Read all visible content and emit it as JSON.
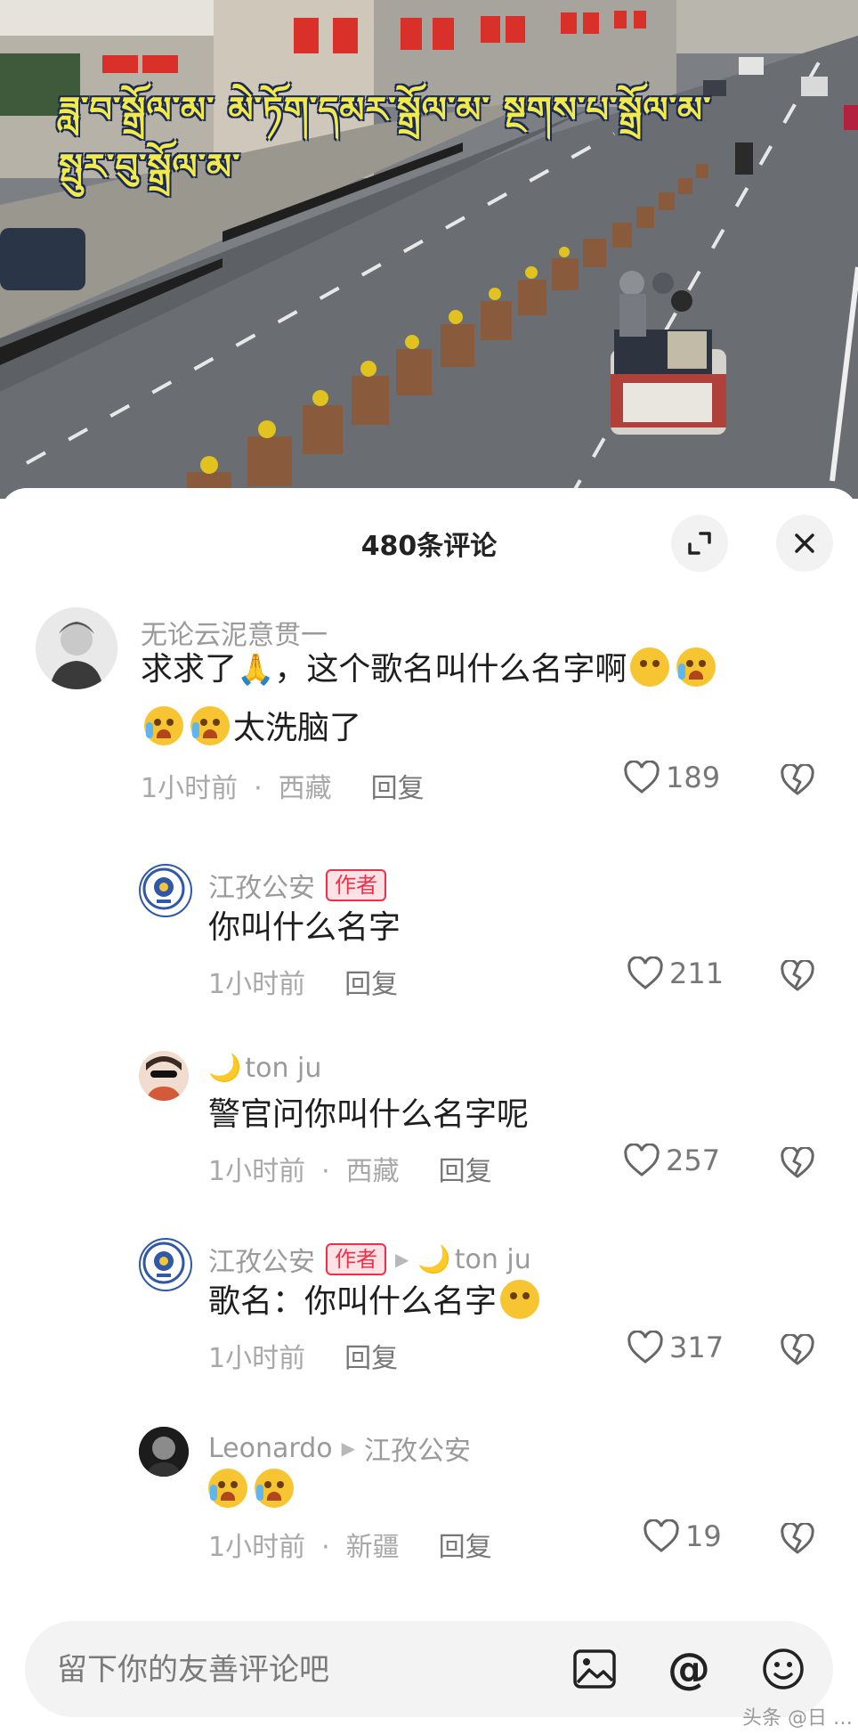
{
  "video": {
    "subtitle_lines": [
      "ཟླ་བ་སྒྲོལ་མ་  མེ་ཏོག་དམར་སྒྲོལ་མ་  སྔགས་པ་སྒྲོལ་མ་",
      "སྤུར་བུ་སྒྲོལ་མ་"
    ]
  },
  "sheet": {
    "title": "480条评论",
    "expand_icon": "expand-icon",
    "close_icon": "close-icon"
  },
  "comments": [
    {
      "user": "无论云泥意贯一",
      "text_line1_a": "求求了",
      "text_line1_b": "，这个歌名叫什么名字啊",
      "text_line2": "太洗脑了",
      "time": "1小时前",
      "location": "西藏",
      "reply": "回复",
      "likes": "189"
    },
    {
      "user": "江孜公安",
      "badge": "作者",
      "text": "你叫什么名字",
      "time": "1小时前",
      "reply": "回复",
      "likes": "211"
    },
    {
      "user": "ton ju",
      "text": "警官问你叫什么名字呢",
      "time": "1小时前",
      "location": "西藏",
      "reply": "回复",
      "likes": "257"
    },
    {
      "user": "江孜公安",
      "badge": "作者",
      "reply_to": "ton ju",
      "text": "歌名：你叫什么名字",
      "time": "1小时前",
      "reply": "回复",
      "likes": "317"
    },
    {
      "user": "Leonardo",
      "reply_to": "江孜公安",
      "time": "1小时前",
      "location": "新疆",
      "reply": "回复",
      "likes": "19"
    }
  ],
  "input": {
    "placeholder": "留下你的友善评论吧",
    "icons": [
      "image-icon",
      "at-icon",
      "emoji-icon"
    ]
  },
  "watermark": "头条 @日 …"
}
